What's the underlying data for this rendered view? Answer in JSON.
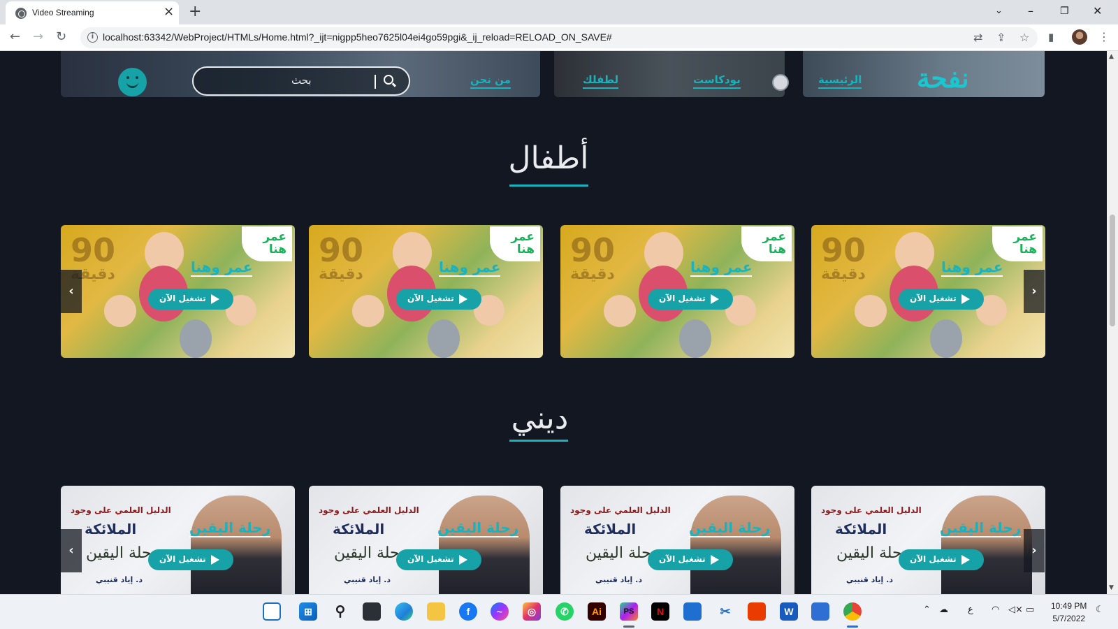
{
  "browser": {
    "tab_title": "Video Streaming",
    "url": "localhost:63342/WebProject/HTMLs/Home.html?_ijt=nigpp5heo7625l04ei4go59pgi&_ij_reload=RELOAD_ON_SAVE#"
  },
  "header": {
    "search_placeholder": "بحث",
    "nav": {
      "about": "من نحن",
      "kids": "لطفلك",
      "podcast": "بودكاست",
      "home": "الرئيسية"
    },
    "brand": "نفحة"
  },
  "sections": [
    {
      "title": "أطفال",
      "cards": [
        {
          "name": "عمر وهنا",
          "badge": "عمر هنا",
          "duration_number": "90",
          "duration_unit": "دقيقة",
          "play_label": "تشغيل الآن"
        },
        {
          "name": "عمر وهنا",
          "badge": "عمر هنا",
          "duration_number": "90",
          "duration_unit": "دقيقة",
          "play_label": "تشغيل الآن"
        },
        {
          "name": "عمر وهنا",
          "badge": "عمر هنا",
          "duration_number": "90",
          "duration_unit": "دقيقة",
          "play_label": "تشغيل الآن"
        },
        {
          "name": "عمر وهنا",
          "badge": "عمر هنا",
          "duration_number": "90",
          "duration_unit": "دقيقة",
          "play_label": "تشغيل الآن"
        }
      ]
    },
    {
      "title": "ديني",
      "cards": [
        {
          "series": "رحلة اليقين",
          "subtitle": "الدليل العلمي على وجود",
          "topic": "الملائكة",
          "calligraphy": "رحلة اليقين",
          "author": "د. إياد قنيبي",
          "play_label": "تشغيل الآن"
        },
        {
          "series": "رحلة اليقين",
          "subtitle": "الدليل العلمي على وجود",
          "topic": "الملائكة",
          "calligraphy": "رحلة اليقين",
          "author": "د. إياد قنيبي",
          "play_label": "تشغيل الآن"
        },
        {
          "series": "رحلة اليقين",
          "subtitle": "الدليل العلمي على وجود",
          "topic": "الملائكة",
          "calligraphy": "رحلة اليقين",
          "author": "د. إياد قنيبي",
          "play_label": "تشغيل الآن"
        },
        {
          "series": "رحلة اليقين",
          "subtitle": "الدليل العلمي على وجود",
          "topic": "الملائكة",
          "calligraphy": "رحلة اليقين",
          "author": "د. إياد قنيبي",
          "play_label": "تشغيل الآن"
        }
      ]
    }
  ],
  "icons": {
    "prev": "chevron-left-icon",
    "next": "chevron-right-icon",
    "play": "play-icon",
    "search": "search-icon"
  },
  "colors": {
    "accent": "#18b3bd",
    "page_bg": "#131722",
    "title_text": "#e9ecef"
  },
  "taskbar": {
    "time": "10:49 PM",
    "date": "5/7/2022",
    "lang": "ع"
  }
}
